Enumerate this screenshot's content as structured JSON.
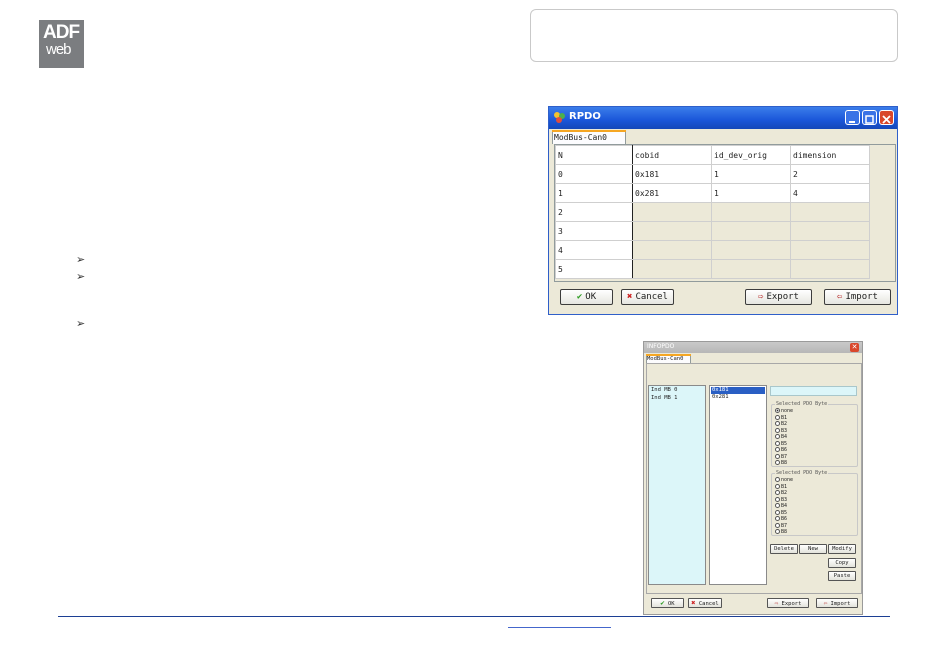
{
  "logo": {
    "line1": "ADF",
    "line2": "web"
  },
  "bullets": [
    "➢",
    "➢",
    "➢"
  ],
  "rpdo": {
    "title": "RPDO",
    "tab": "ModBus-Can0",
    "columns": [
      "N",
      "cobid",
      "id_dev_orig",
      "dimension"
    ],
    "rows": [
      [
        "0",
        "0x181",
        "1",
        "2"
      ],
      [
        "1",
        "0x281",
        "1",
        "4"
      ],
      [
        "2",
        "",
        "",
        ""
      ],
      [
        "3",
        "",
        "",
        ""
      ],
      [
        "4",
        "",
        "",
        ""
      ],
      [
        "5",
        "",
        "",
        ""
      ]
    ],
    "buttons": {
      "ok": "OK",
      "cancel": "Cancel",
      "export": "Export",
      "import": "Import"
    }
  },
  "infopdo": {
    "title": "INFOPDO",
    "tab": "ModBus-Can0",
    "left_list": [
      "Ind MB 0",
      "Ind MB 1"
    ],
    "mid_list": [
      "0x181",
      "0x281"
    ],
    "mid_selected": "0x181",
    "group1": {
      "label": "Selected PDO Byte",
      "options": [
        "none",
        "B1",
        "B2",
        "B3",
        "B4",
        "B5",
        "B6",
        "B7",
        "B8"
      ],
      "selected": "none"
    },
    "group2": {
      "label": "Selected PDO Byte",
      "options": [
        "none",
        "B1",
        "B2",
        "B3",
        "B4",
        "B5",
        "B6",
        "B7",
        "B8"
      ],
      "selected": ""
    },
    "buttons": {
      "delete": "Delete",
      "new": "New",
      "modify": "Modify",
      "copy": "Copy",
      "paste": "Paste",
      "ok": "OK",
      "cancel": "Cancel",
      "export": "Export",
      "import": "Import"
    }
  },
  "colors": {
    "xp_title": "#1a56d9",
    "accent_tab": "#f5a623",
    "list_bg": "#dcf6f9",
    "footer_line": "#1c3f94"
  }
}
